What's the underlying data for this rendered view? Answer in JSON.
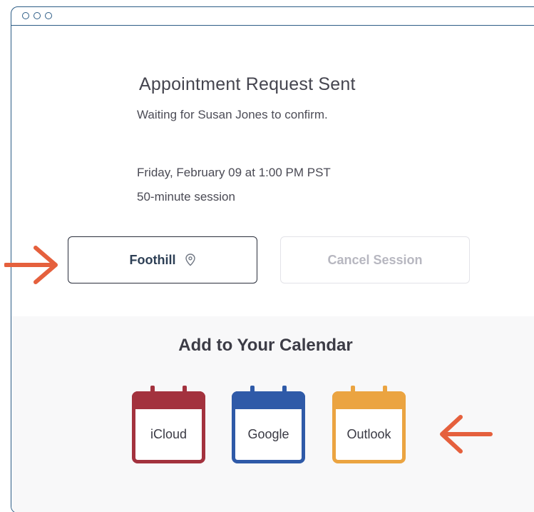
{
  "confirmation": {
    "title": "Appointment Request Sent",
    "subtitle": "Waiting for Susan Jones to confirm.",
    "datetime": "Friday, February 09 at 1:00 PM PST",
    "duration": "50-minute session"
  },
  "actions": {
    "location_label": "Foothill",
    "location_icon": "map-pin-icon",
    "cancel_label": "Cancel Session"
  },
  "calendar": {
    "heading": "Add to Your Calendar",
    "options": [
      {
        "label": "iCloud",
        "color": "#a3323e"
      },
      {
        "label": "Google",
        "color": "#2f5aa8"
      },
      {
        "label": "Outlook",
        "color": "#eba441"
      }
    ]
  },
  "colors": {
    "frame": "#2d5d86",
    "arrow": "#e5603d",
    "primary_text": "#2d3f55",
    "disabled_text": "#b7b7c0"
  }
}
